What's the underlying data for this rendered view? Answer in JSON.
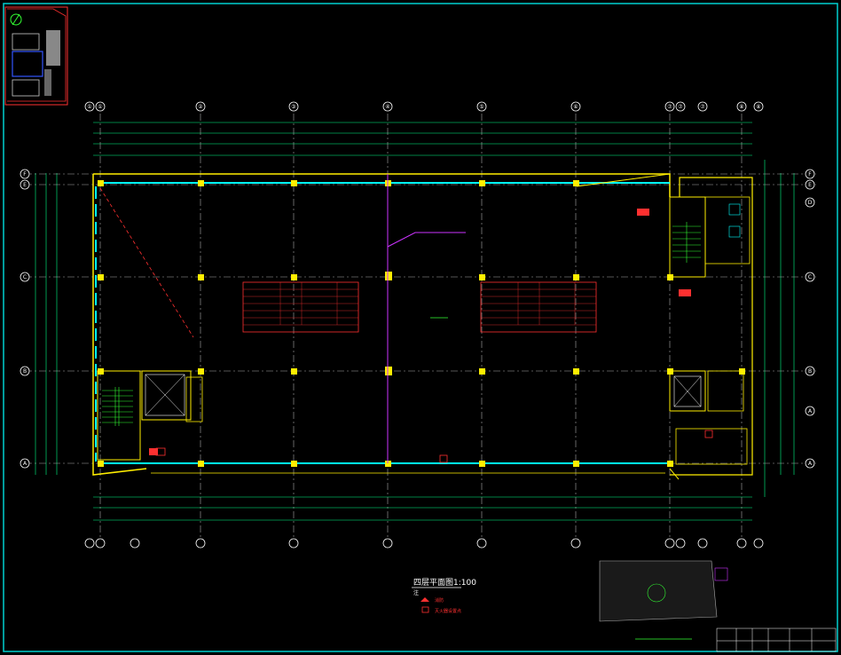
{
  "drawing": {
    "title": "四层平面图1:100",
    "title_sub": "注",
    "legend": [
      {
        "icon": "fire-hydrant-icon",
        "text": "消防"
      },
      {
        "icon": "extinguisher-icon",
        "text": "灭火器设置点"
      }
    ],
    "axes_top": [
      "①",
      "①",
      "②",
      "③",
      "④",
      "⑤",
      "⑥",
      "⑦",
      "⑦",
      "⑦",
      "⑧",
      "⑧"
    ],
    "axes_side": [
      "F",
      "E",
      "C",
      "B",
      "A"
    ],
    "axes_right": [
      "F",
      "E",
      "D",
      "C",
      "B",
      "A",
      "A"
    ],
    "colors": {
      "background": "#000000",
      "frame": "#00cfcf",
      "grid": "#ffffff",
      "columns": "#ffee00",
      "walls": "#00ffff",
      "annotation": "#ff3030",
      "stairs": "#33ff33",
      "magenta": "#cc33ff"
    }
  }
}
